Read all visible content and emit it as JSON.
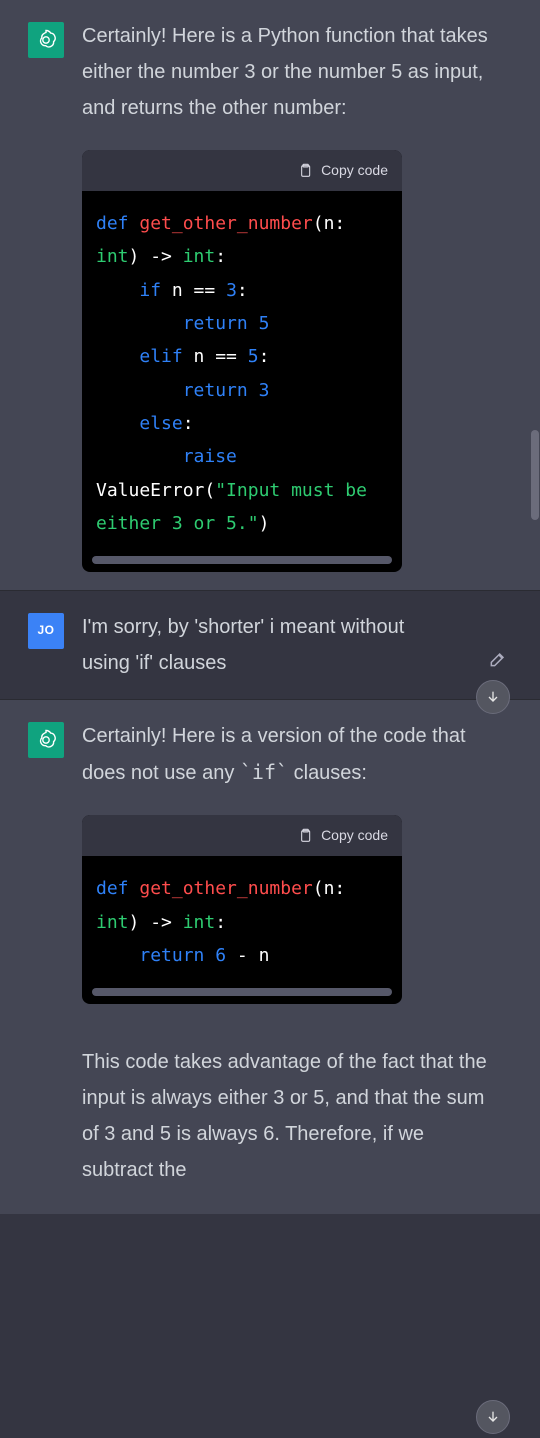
{
  "avatars": {
    "assistant_alt": "assistant-logo",
    "user_initials": "JO"
  },
  "copy_label": "Copy code",
  "messages": {
    "m1": {
      "role": "assistant",
      "text": "Certainly! Here is a Python function that takes either the number 3 or the number 5 as input, and returns the other number:",
      "code": {
        "tokens": [
          {
            "t": "def ",
            "c": "tok-kw"
          },
          {
            "t": "get_other_number",
            "c": "tok-fn"
          },
          {
            "t": "(n: ",
            "c": ""
          },
          {
            "t": "int",
            "c": "tok-type"
          },
          {
            "t": ") -> ",
            "c": ""
          },
          {
            "t": "int",
            "c": "tok-type"
          },
          {
            "t": ":\n",
            "c": ""
          },
          {
            "t": "    if ",
            "c": "tok-kw"
          },
          {
            "t": "n == ",
            "c": ""
          },
          {
            "t": "3",
            "c": "tok-num"
          },
          {
            "t": ":\n",
            "c": ""
          },
          {
            "t": "        return ",
            "c": "tok-kw"
          },
          {
            "t": "5",
            "c": "tok-num"
          },
          {
            "t": "\n",
            "c": ""
          },
          {
            "t": "    elif ",
            "c": "tok-kw"
          },
          {
            "t": "n == ",
            "c": ""
          },
          {
            "t": "5",
            "c": "tok-num"
          },
          {
            "t": ":\n",
            "c": ""
          },
          {
            "t": "        return ",
            "c": "tok-kw"
          },
          {
            "t": "3",
            "c": "tok-num"
          },
          {
            "t": "\n",
            "c": ""
          },
          {
            "t": "    else",
            "c": "tok-kw"
          },
          {
            "t": ":\n",
            "c": ""
          },
          {
            "t": "        raise",
            "c": "tok-kw"
          },
          {
            "t": " ",
            "c": ""
          },
          {
            "t": "ValueError",
            "c": ""
          },
          {
            "t": "(",
            "c": ""
          },
          {
            "t": "\"Input must be either 3 or 5.\"",
            "c": "tok-str"
          },
          {
            "t": ")",
            "c": ""
          }
        ]
      }
    },
    "m2": {
      "role": "user",
      "text": "I'm sorry, by 'shorter' i meant without using 'if' clauses"
    },
    "m3": {
      "role": "assistant",
      "text_pre": "Certainly! Here is a version of the code that does not use any ",
      "inline_code": "`if`",
      "text_post": " clauses:",
      "code": {
        "tokens": [
          {
            "t": "def ",
            "c": "tok-kw"
          },
          {
            "t": "get_other_number",
            "c": "tok-fn"
          },
          {
            "t": "(n: ",
            "c": ""
          },
          {
            "t": "int",
            "c": "tok-type"
          },
          {
            "t": ") -> ",
            "c": ""
          },
          {
            "t": "int",
            "c": "tok-type"
          },
          {
            "t": ":\n",
            "c": ""
          },
          {
            "t": "    return ",
            "c": "tok-kw"
          },
          {
            "t": "6",
            "c": "tok-num"
          },
          {
            "t": " - n",
            "c": ""
          }
        ]
      },
      "explain": "This code takes advantage of the fact that the input is always either 3 or 5, and that the sum of 3 and 5 is always 6. Therefore, if we subtract the"
    }
  }
}
